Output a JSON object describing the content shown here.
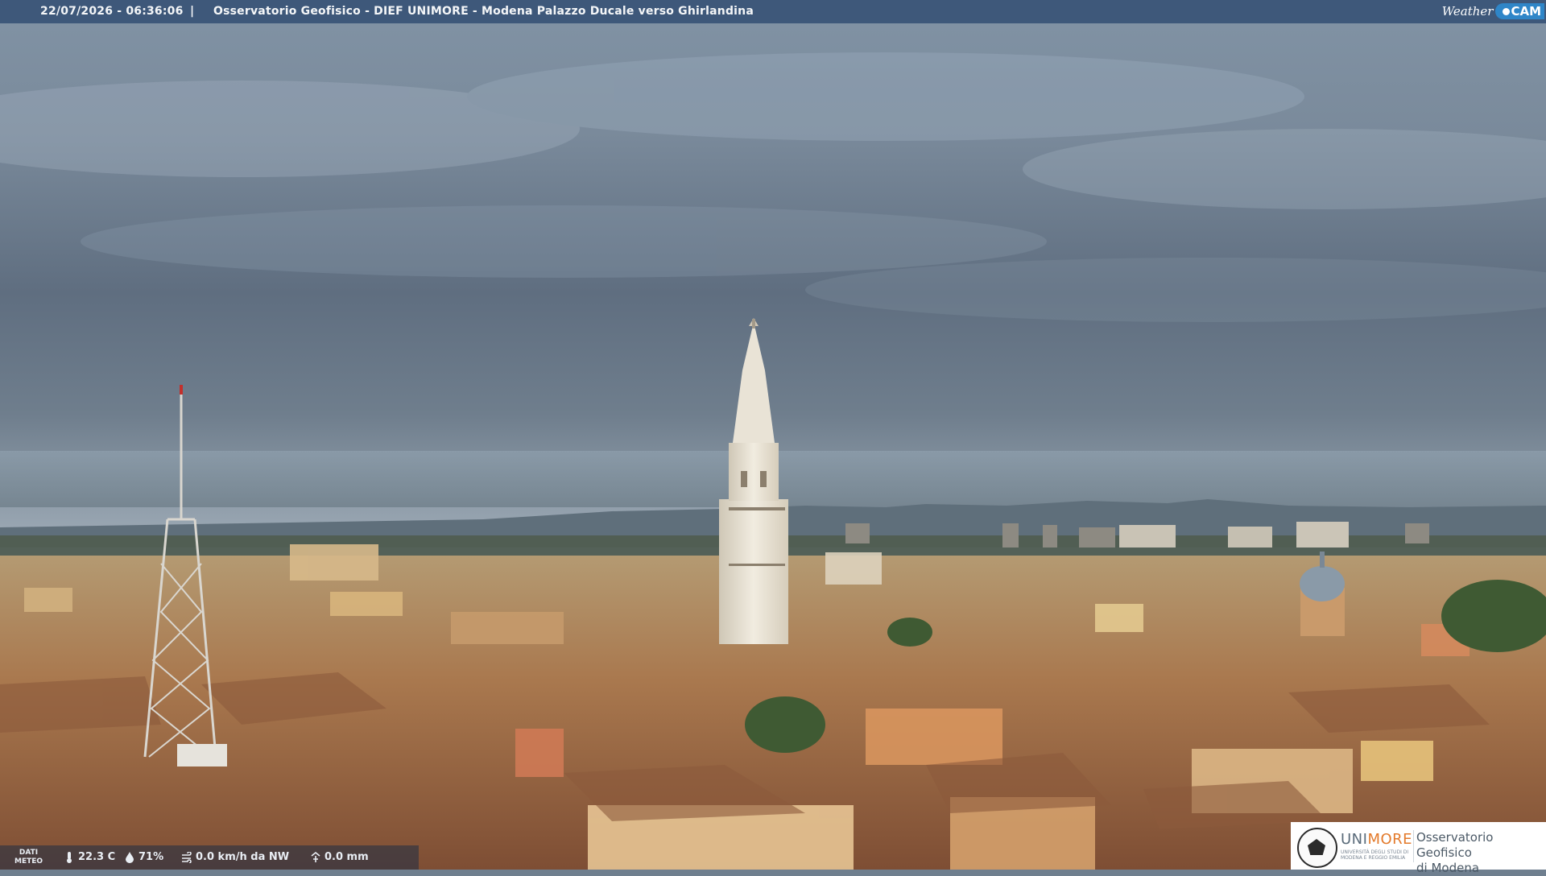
{
  "overlay": {
    "timestamp": "22/07/2026 - 06:36:06",
    "separator": "|",
    "caption": "Osservatorio Geofisico - DIEF UNIMORE - Modena Palazzo Ducale verso Ghirlandina",
    "brand_weather": "Weather",
    "brand_cam": "CAM"
  },
  "weather_data": {
    "label_line1": "DATI",
    "label_line2": "METEO",
    "temperature": "22.3 C",
    "humidity": "71%",
    "wind": "0.0 km/h da NW",
    "rain": "0.0 mm",
    "icons": [
      "thermometer-icon",
      "humidity-drop-icon",
      "wind-icon",
      "rain-gauge-icon"
    ]
  },
  "logo": {
    "uni_prefix": "UNI",
    "uni_suffix": "MORE",
    "uni_sub1": "UNIVERSITÀ DEGLI STUDI DI",
    "uni_sub2": "MODENA E REGGIO EMILIA",
    "obs_line1": "Osservatorio Geofisico",
    "obs_line2": "di Modena"
  },
  "colors": {
    "bar_bg": "#2c486e",
    "cam_badge": "#2f86c8",
    "unimore_orange": "#e37a2b"
  }
}
